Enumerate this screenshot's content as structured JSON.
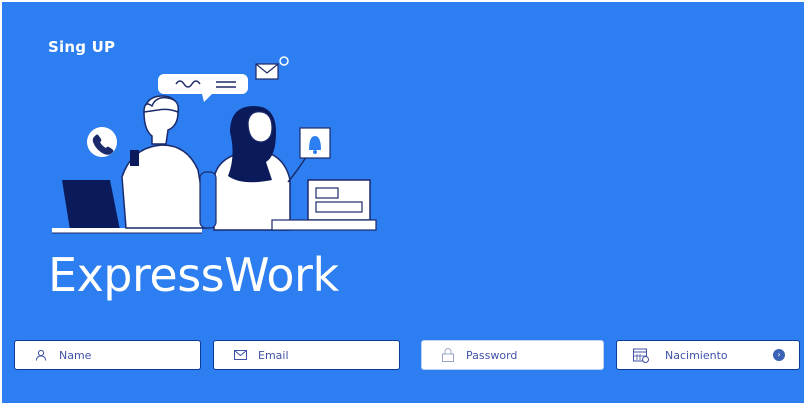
{
  "header": {
    "signup_label": "Sing UP"
  },
  "brand": {
    "title": "ExpressWork"
  },
  "form": {
    "name_placeholder": "Name",
    "email_placeholder": "Email",
    "password_placeholder": "Password",
    "birth_label": "Nacimiento"
  },
  "colors": {
    "background": "#2d7ef0",
    "field_border": "#0b3b95",
    "field_text": "#3f51a6"
  },
  "icons": [
    "user-icon",
    "mail-icon",
    "lock-icon",
    "calendar-icon",
    "chevron-right-icon"
  ]
}
